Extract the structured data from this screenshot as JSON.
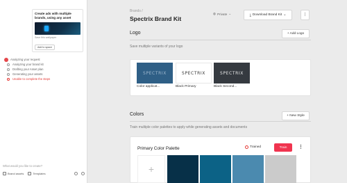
{
  "left": {
    "promo": {
      "title": "Create ads with multiple brands, using any asset",
      "caption": "Save this wallpaper",
      "button": "Add to space"
    },
    "steps": [
      "Analyzing your request",
      "Analyzing your brand kit",
      "Drafting your Asset plan",
      "Generating your assets",
      "Unable to complete the steps"
    ],
    "ask_placeholder": "What would you like to create?",
    "ask_chip_1": "Brand assets",
    "ask_chip_2": "Templates"
  },
  "main": {
    "breadcrumb": "Brands /",
    "title": "Spectrix Brand Kit",
    "private_label": "Private",
    "download_label": "Download Brand Kit",
    "more_label": "⋮",
    "logo": {
      "header": "Logo",
      "add_label": "+ Add Logo",
      "desc": "Save multiple variants of your logo",
      "cards": [
        {
          "text": "SPECTRIX",
          "label": "Color applicat...",
          "bg": "#2f5f86",
          "fg": "#9fb8cf"
        },
        {
          "text": "SPECTRIX",
          "label": "Black Primary",
          "bg": "#ffffff",
          "fg": "#333333"
        },
        {
          "text": "SPECTRIX",
          "label": "Black Second...",
          "bg": "#353a40",
          "fg": "#e8e8e8"
        }
      ]
    },
    "colors": {
      "header": "Colors",
      "add_label": "+ New Style",
      "desc": "Train multiple color palettes to apply while generating assets and documents",
      "palette_title": "Primary Color Palette",
      "trained_label": "Trained",
      "train_label": "Train",
      "more_label": "⋮",
      "swatches": [
        "#073048",
        "#0c6286",
        "#4b8aaf",
        "#cbcbcb"
      ]
    }
  }
}
